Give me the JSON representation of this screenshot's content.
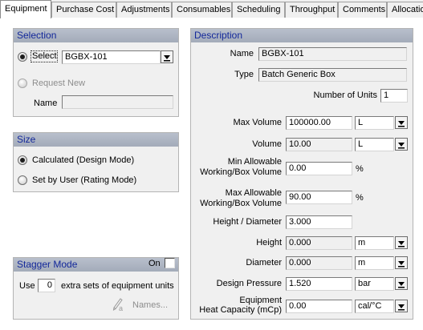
{
  "tabs": [
    "Equipment",
    "Purchase Cost",
    "Adjustments",
    "Consumables",
    "Scheduling",
    "Throughput",
    "Comments",
    "Allocatio"
  ],
  "selection": {
    "header": "Selection",
    "select_label": "Select",
    "equipment_value": "BGBX-101",
    "request_new_label": "Request New",
    "name_label": "Name",
    "name_value": ""
  },
  "size": {
    "header": "Size",
    "calculated_label": "Calculated (Design Mode)",
    "set_by_user_label": "Set by User (Rating Mode)"
  },
  "stagger": {
    "header": "Stagger Mode",
    "on_label": "On",
    "use_label": "Use",
    "count": "0",
    "suffix_label": "extra sets of equipment units",
    "names_label": "Names..."
  },
  "description": {
    "header": "Description",
    "name_label": "Name",
    "name_value": "BGBX-101",
    "type_label": "Type",
    "type_value": "Batch Generic Box",
    "units_label": "Number of Units",
    "units_value": "1",
    "max_volume_label": "Max Volume",
    "max_volume_value": "100000.00",
    "max_volume_unit": "L",
    "volume_label": "Volume",
    "volume_value": "10.00",
    "volume_unit": "L",
    "min_allow_label_1": "Min Allowable",
    "min_allow_label_2": "Working/Box Volume",
    "min_allow_value": "0.00",
    "min_allow_unit": "%",
    "max_allow_label_1": "Max Allowable",
    "max_allow_label_2": "Working/Box Volume",
    "max_allow_value": "90.00",
    "max_allow_unit": "%",
    "hd_label": "Height / Diameter",
    "hd_value": "3.000",
    "height_label": "Height",
    "height_value": "0.000",
    "height_unit": "m",
    "diameter_label": "Diameter",
    "diameter_value": "0.000",
    "diameter_unit": "m",
    "pressure_label": "Design Pressure",
    "pressure_value": "1.520",
    "pressure_unit": "bar",
    "heat_label_1": "Equipment",
    "heat_label_2": "Heat Capacity (mCp)",
    "heat_value": "0.00",
    "heat_unit": "cal/°C"
  }
}
